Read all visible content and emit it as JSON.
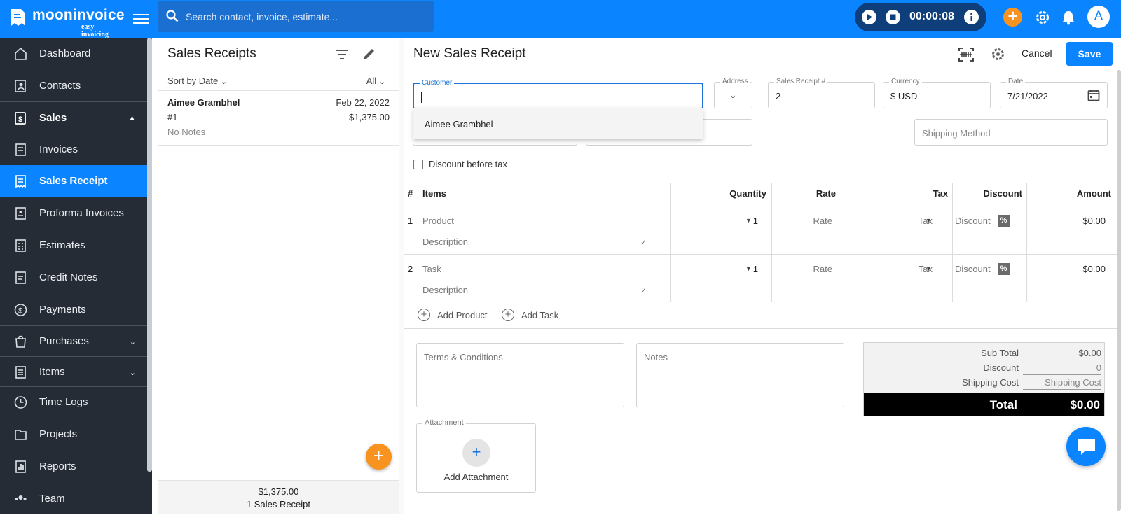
{
  "app": {
    "name": "mooninvoice",
    "tagline": "easy invoicing"
  },
  "search": {
    "placeholder": "Search contact, invoice, estimate..."
  },
  "timer": {
    "time": "00:00:08"
  },
  "user": {
    "initial": "A"
  },
  "sidebar": {
    "items": [
      {
        "label": "Dashboard",
        "icon": "home-icon"
      },
      {
        "label": "Contacts",
        "icon": "contacts-icon"
      },
      {
        "label": "Sales",
        "icon": "sales-icon"
      },
      {
        "label": "Invoices",
        "icon": "invoice-icon"
      },
      {
        "label": "Sales Receipt",
        "icon": "receipt-icon"
      },
      {
        "label": "Proforma Invoices",
        "icon": "proforma-icon"
      },
      {
        "label": "Estimates",
        "icon": "estimate-icon"
      },
      {
        "label": "Credit Notes",
        "icon": "credit-note-icon"
      },
      {
        "label": "Payments",
        "icon": "dollar-icon"
      },
      {
        "label": "Purchases",
        "icon": "bag-icon"
      },
      {
        "label": "Items",
        "icon": "items-icon"
      },
      {
        "label": "Time Logs",
        "icon": "clock-icon"
      },
      {
        "label": "Projects",
        "icon": "folder-icon"
      },
      {
        "label": "Reports",
        "icon": "chart-icon"
      },
      {
        "label": "Team",
        "icon": "team-icon"
      }
    ]
  },
  "list": {
    "title": "Sales Receipts",
    "sort": "Sort by Date",
    "filter": "All",
    "items": [
      {
        "name": "Aimee Grambhel",
        "date": "Feb 22, 2022",
        "number": "#1",
        "amount": "$1,375.00",
        "notes": "No Notes"
      }
    ],
    "footer_total": "$1,375.00",
    "footer_count": "1 Sales Receipt"
  },
  "form": {
    "title": "New Sales Receipt",
    "cancel": "Cancel",
    "save": "Save",
    "customer_label": "Customer",
    "customer_suggestion": "Aimee Grambhel",
    "address_label": "Address",
    "receipt_no_label": "Sales Receipt #",
    "receipt_no": "2",
    "currency_label": "Currency",
    "currency": "$ USD",
    "date_label": "Date",
    "date": "7/21/2022",
    "shipping_method": "Shipping Method",
    "discount_before_tax": "Discount before tax"
  },
  "table": {
    "headers": {
      "num": "#",
      "items": "Items",
      "quantity": "Quantity",
      "rate": "Rate",
      "tax": "Tax",
      "discount": "Discount",
      "amount": "Amount"
    },
    "rows": [
      {
        "num": "1",
        "item": "Product",
        "desc": "Description",
        "qty": "1",
        "rate": "Rate",
        "tax": "Tax",
        "discount": "Discount",
        "pct": "%",
        "amount": "$0.00"
      },
      {
        "num": "2",
        "item": "Task",
        "desc": "Description",
        "qty": "1",
        "rate": "Rate",
        "tax": "Tax",
        "discount": "Discount",
        "pct": "%",
        "amount": "$0.00"
      }
    ],
    "add_product": "Add Product",
    "add_task": "Add Task"
  },
  "terms": "Terms & Conditions",
  "notes": "Notes",
  "totals": {
    "subtotal_label": "Sub Total",
    "subtotal": "$0.00",
    "discount_label": "Discount",
    "discount": "0",
    "shipping_label": "Shipping Cost",
    "shipping": "Shipping Cost",
    "total_label": "Total",
    "total": "$0.00"
  },
  "attachment": {
    "label": "Attachment",
    "action": "Add Attachment"
  },
  "colors": {
    "primary": "#0a84ff",
    "accent": "#f7931e",
    "sidebar": "#252c36"
  }
}
